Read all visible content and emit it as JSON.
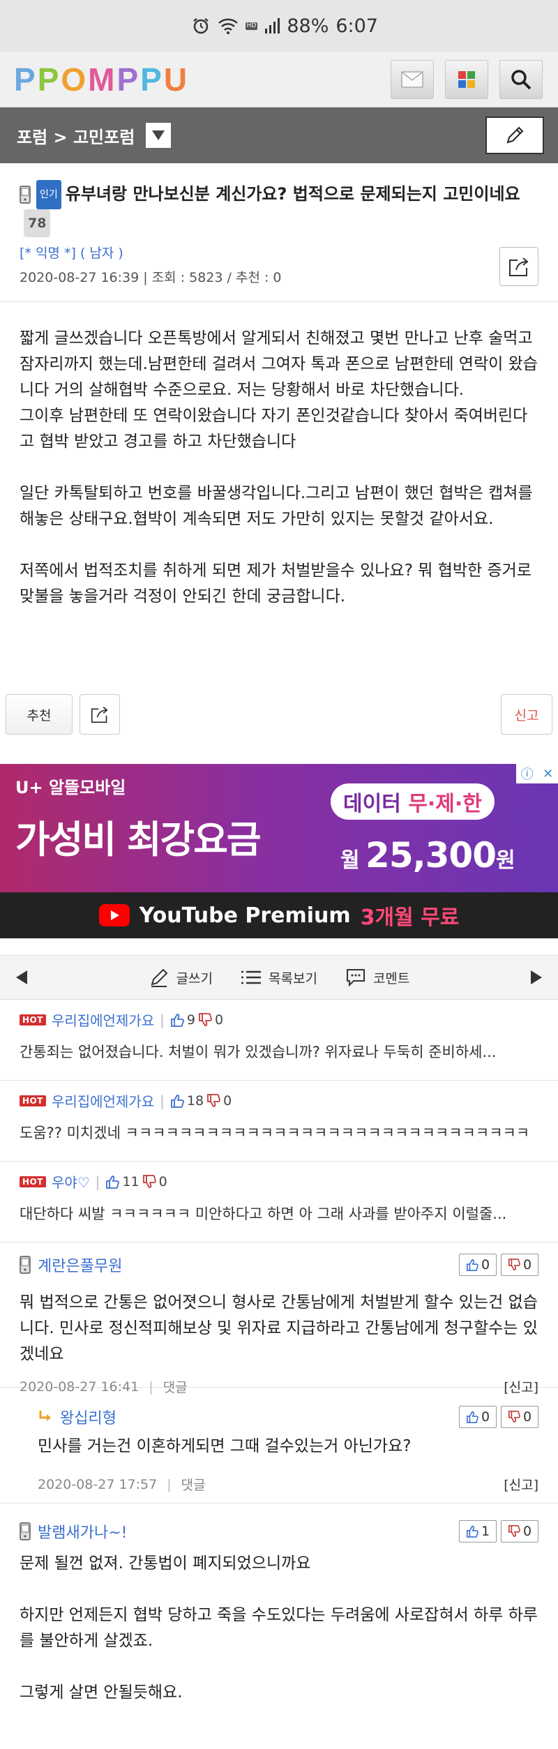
{
  "status": {
    "battery": "88%",
    "time": "6:07",
    "hd": "HD"
  },
  "logo": {
    "letters": [
      "P",
      "P",
      "O",
      "M",
      "P",
      "P",
      "U"
    ],
    "colors": [
      "#6aa8e0",
      "#8cc63f",
      "#f0a030",
      "#e05a9a",
      "#a070d0",
      "#50b8e0",
      "#f08040"
    ]
  },
  "forum": {
    "breadcrumb": "포럼 > 고민포럼"
  },
  "post": {
    "hot_tag": "인기",
    "title": "유부녀랑 만나보신분 계신가요? 법적으로 문제되는지 고민이네요",
    "comment_count": "78",
    "author": "[* 익명 *] ( 남자 )",
    "meta": "2020-08-27 16:39 | 조회 : 5823 / 추천 : 0",
    "paragraphs": [
      "짧게 글쓰겠습니다 오픈톡방에서 알게되서 친해졌고 몇번 만나고 난후 술먹고 잠자리까지 했는데.남편한테 걸려서 그여자 톡과 폰으로  남편한테 연락이 왔습니다 거의 살해협박 수준으로요. 저는 당황해서  바로 차단했습니다.\n그이후 남편한테 또 연락이왔습니다 자기 폰인것같습니다 찾아서 죽여버린다고 협박 받았고 경고를 하고 차단했습니다",
      "일단 카톡탈퇴하고 번호를 바꿀생각입니다.그리고 남편이 했던 협박은 캡쳐를 해놓은 상태구요.협박이 계속되면 저도 가만히 있지는 못할것 같아서요.",
      "저쪽에서 법적조치를 취하게 되면 제가 처벌받을수 있나요? 뭐 협박한 증거로 맞불을 놓을거라 걱정이 안되긴 한데 궁금합니다."
    ],
    "recommend_label": "추천",
    "report_label": "신고"
  },
  "ad": {
    "brand": "U+ 알뜰모바일",
    "headline": "가성비 최강요금",
    "data_prefix": "데이터 ",
    "data_highlight": "무·제·한",
    "price_prefix": "월 ",
    "price": "25,300",
    "price_unit": "원",
    "youtube": "YouTube Premium",
    "youtube_offer": "3개월 무료"
  },
  "comment_nav": {
    "write": "글쓰기",
    "list": "목록보기",
    "comment": "코멘트"
  },
  "hot_comments": [
    {
      "badge": "HOT",
      "nick": "우리집에언제가요",
      "up": "9",
      "down": "0",
      "text": "간통죄는 없어졌습니다. 처벌이 뭐가 있겠습니까? 위자료나 두둑히 준비하세..."
    },
    {
      "badge": "HOT",
      "nick": "우리집에언제가요",
      "up": "18",
      "down": "0",
      "text": "도움?? 미치겠네 ㅋㅋㅋㅋㅋㅋㅋㅋㅋㅋㅋㅋㅋㅋㅋㅋㅋㅋㅋㅋㅋㅋㅋㅋㅋㅋㅋㅋㅋㅋ"
    },
    {
      "badge": "HOT",
      "nick": "우야♡",
      "up": "11",
      "down": "0",
      "text": "대단하다 씨발 ㅋㅋㅋㅋㅋㅋ 미안하다고 하면 아 그래 사과를 받아주지 이럴줄..."
    }
  ],
  "comments": [
    {
      "nick": "계란은풀무원",
      "up": "0",
      "down": "0",
      "text": "뭐 법적으로 간통은 없어졋으니 형사로 간통남에게 처벌받게 할수 있는건 없습니다. 민사로 정신적피해보상 및 위자료 지급하라고 간통남에게 청구할수는 있겠네요",
      "date": "2020-08-27 16:41",
      "reply": "댓글",
      "report": "[신고]"
    },
    {
      "nick": "왕십리형",
      "up": "0",
      "down": "0",
      "text": "민사를 거는건 이혼하게되면 그때 걸수있는거 아닌가요?",
      "date": "2020-08-27 17:57",
      "reply": "댓글",
      "report": "[신고]"
    },
    {
      "nick": "발램새가나~!",
      "up": "1",
      "down": "0",
      "text1": "문제 될껀 없져. 간통법이 폐지되었으니까요",
      "text2": "하지만 언제든지 협박 당하고 죽을 수도있다는 두려움에 사로잡혀서 하루 하루를 불안하게 살겠죠.",
      "text3": "그렇게 살면 안될듯해요."
    }
  ]
}
